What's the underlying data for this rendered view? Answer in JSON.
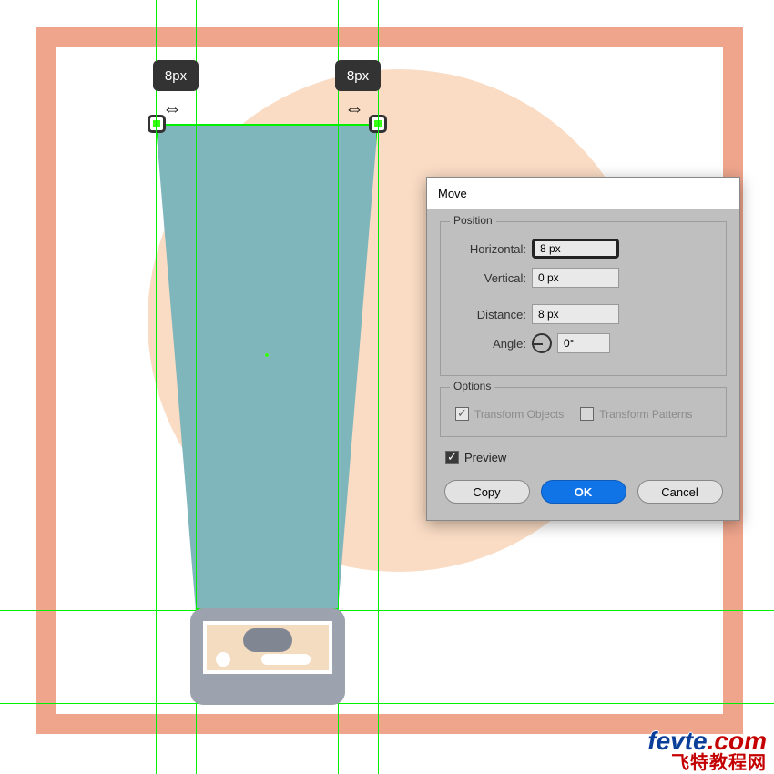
{
  "measure": {
    "left_badge": "8px",
    "right_badge": "8px"
  },
  "dialog": {
    "title": "Move",
    "position_group": "Position",
    "horizontal_label": "Horizontal:",
    "horizontal_value": "8 px",
    "vertical_label": "Vertical:",
    "vertical_value": "0 px",
    "distance_label": "Distance:",
    "distance_value": "8 px",
    "angle_label": "Angle:",
    "angle_value": "0°",
    "options_group": "Options",
    "transform_objects": "Transform Objects",
    "transform_patterns": "Transform Patterns",
    "preview": "Preview",
    "copy": "Copy",
    "ok": "OK",
    "cancel": "Cancel"
  },
  "watermark": {
    "domain": "fevte",
    "dotcom": ".com",
    "tagline": "飞特教程网"
  }
}
